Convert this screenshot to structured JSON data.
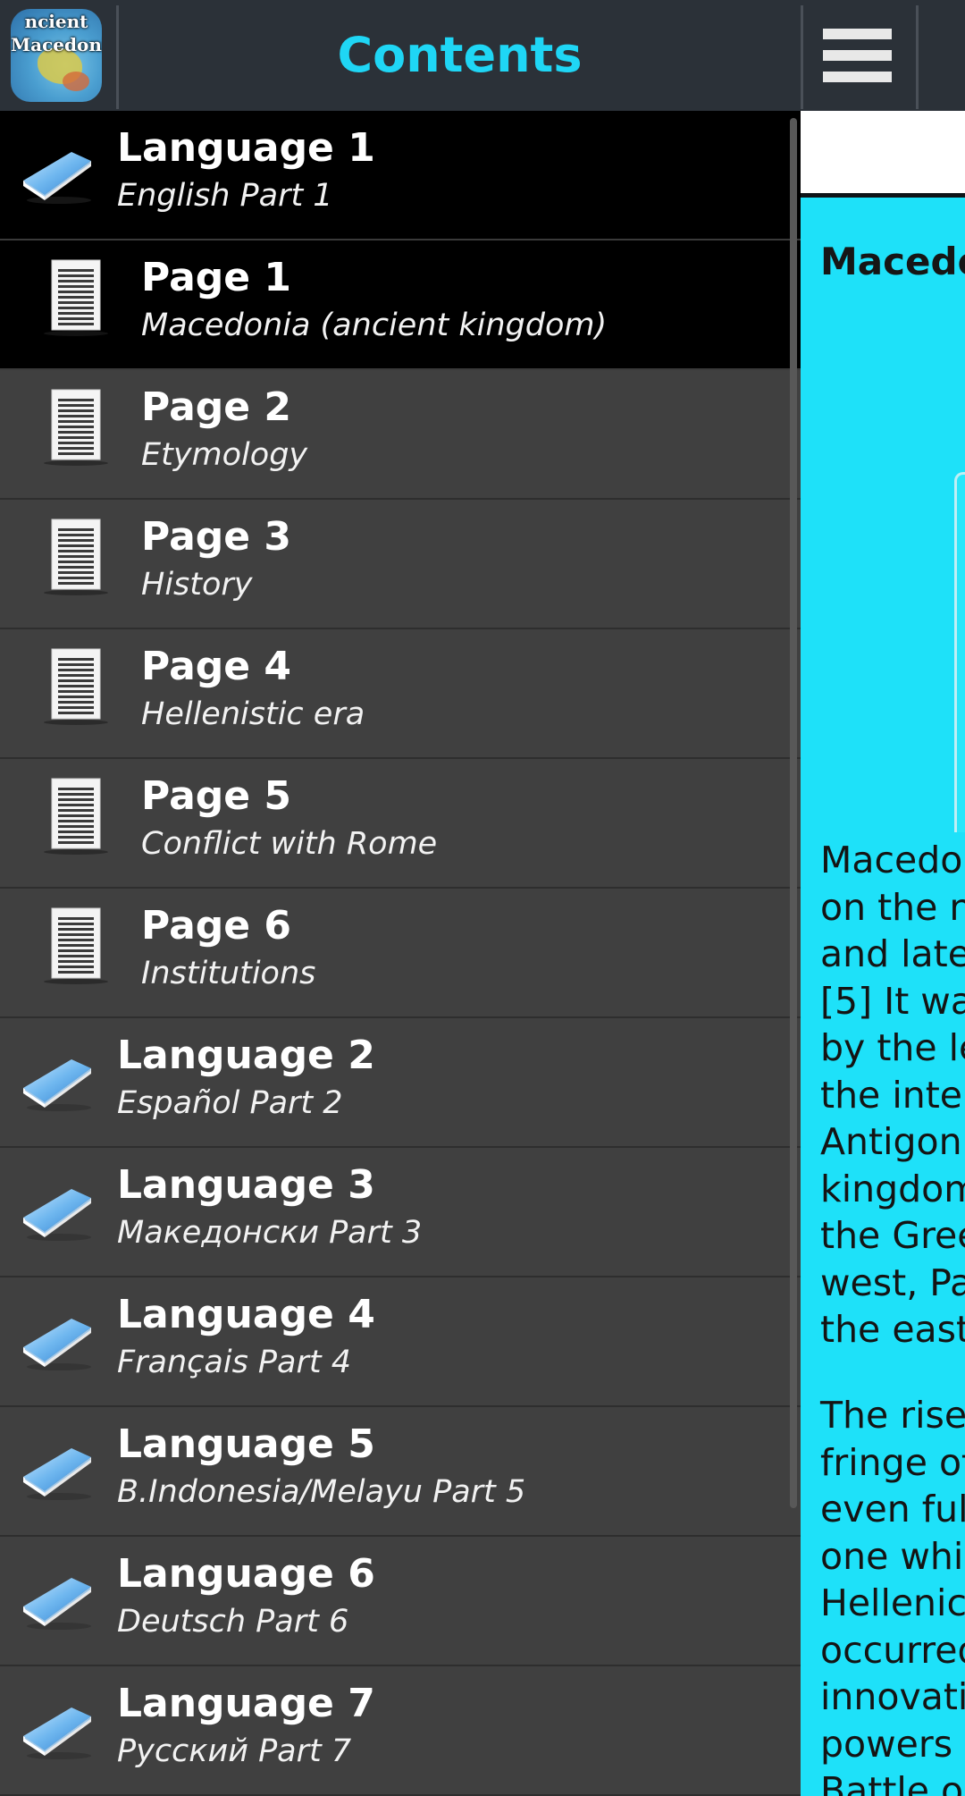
{
  "drawer": {
    "title": "Contents",
    "logo": {
      "line1": "ncient",
      "line2": "Macedonia"
    },
    "items": [
      {
        "type": "language",
        "title": "Language 1",
        "subtitle": "English Part 1",
        "selected": true
      },
      {
        "type": "page",
        "title": "Page 1",
        "subtitle": "Macedonia (ancient kingdom)",
        "selected": true
      },
      {
        "type": "page",
        "title": "Page 2",
        "subtitle": "Etymology"
      },
      {
        "type": "page",
        "title": "Page 3",
        "subtitle": "History"
      },
      {
        "type": "page",
        "title": "Page 4",
        "subtitle": "Hellenistic era"
      },
      {
        "type": "page",
        "title": "Page 5",
        "subtitle": "Conflict with Rome"
      },
      {
        "type": "page",
        "title": "Page 6",
        "subtitle": "Institutions"
      },
      {
        "type": "language",
        "title": "Language 2",
        "subtitle": "Español Part 2"
      },
      {
        "type": "language",
        "title": "Language 3",
        "subtitle": "Македонски Part 3"
      },
      {
        "type": "language",
        "title": "Language 4",
        "subtitle": "Français Part 4"
      },
      {
        "type": "language",
        "title": "Language 5",
        "subtitle": "B.Indonesia/Melayu Part 5"
      },
      {
        "type": "language",
        "title": "Language 6",
        "subtitle": "Deutsch Part 6"
      },
      {
        "type": "language",
        "title": "Language 7",
        "subtitle": "Русский Part 7"
      }
    ]
  },
  "content": {
    "menu_icon": "hamburger-menu-icon",
    "heading": "Macedo",
    "paragraph1": [
      "Macedo",
      "on the n",
      "and late",
      "[5] It wa",
      "by the le",
      "the inter",
      "Antigon",
      "kingdom",
      "the Gree",
      "west, Pa",
      "the east"
    ],
    "paragraph2": [
      "The rise",
      "fringe of",
      "even ful",
      "one whic",
      "Hellenic",
      "occurred",
      "innovati",
      "powers",
      "Battle o"
    ]
  },
  "colors": {
    "accent": "#1fd6f5",
    "content_background": "#1ee1f9",
    "header_background": "#2b3138",
    "drawer_background": "#404040",
    "selected_row": "#000000"
  }
}
